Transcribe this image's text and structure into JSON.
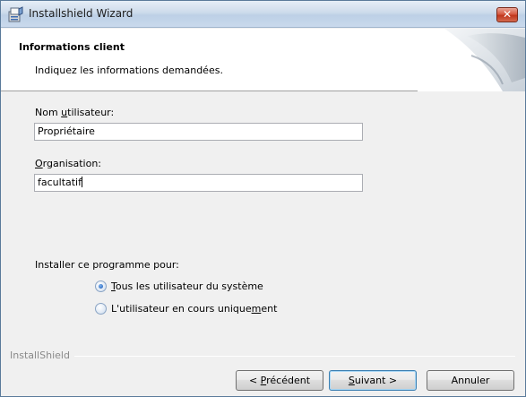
{
  "window": {
    "title": "Installshield Wizard",
    "close_label": "✕"
  },
  "header": {
    "title": "Informations client",
    "subtitle": "Indiquez les informations demandées."
  },
  "form": {
    "username": {
      "label_pre": "Nom ",
      "label_accel": "u",
      "label_post": "tilisateur:",
      "value": "Propriétaire"
    },
    "organisation": {
      "label_pre": "",
      "label_accel": "O",
      "label_post": "rganisation:",
      "value": "facultatif"
    },
    "install_for_label": "Installer ce programme pour:",
    "options": [
      {
        "accel": "T",
        "rest": "ous les utilisateur du système",
        "checked": true
      },
      {
        "pre": "L'utilisateur en cours unique",
        "accel": "m",
        "post": "ent",
        "checked": false
      }
    ]
  },
  "footer": {
    "brand": "InstallShield"
  },
  "buttons": {
    "back": {
      "pre": "< ",
      "accel": "P",
      "post": "récédent"
    },
    "next": {
      "accel": "S",
      "post": "uivant >"
    },
    "cancel": "Annuler"
  },
  "colors": {
    "close_red": "#c0361d",
    "primary_border": "#3c7fb1",
    "radio_dot": "#1f5eb8"
  }
}
